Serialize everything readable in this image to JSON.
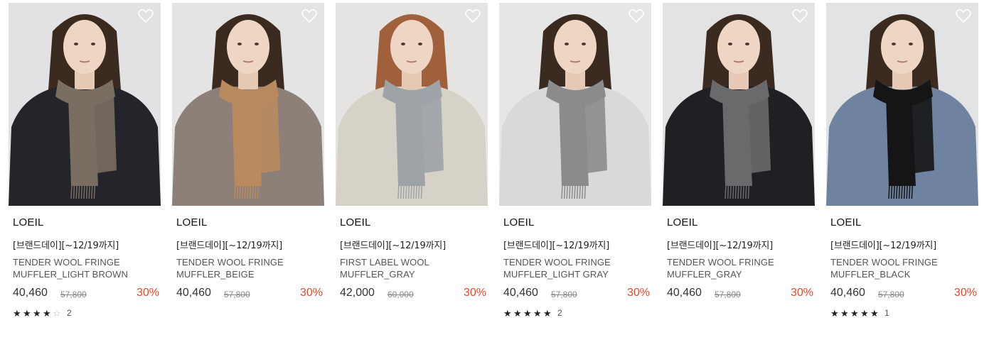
{
  "products": [
    {
      "brand": "LOEIL",
      "promo": "[브랜드데이][~12/19까지]",
      "name_line1": "TENDER WOOL FRINGE",
      "name_line2": "MUFFLER_LIGHT BROWN",
      "price": "40,460",
      "original_price": "57,800",
      "discount": "30%",
      "rating": {
        "stars": 4,
        "max": 5,
        "count": "2"
      },
      "scarf_color": "#7a6d62",
      "top_color": "#24242a",
      "background_color": "#e2e2e4",
      "hair_color": "#3a2a20"
    },
    {
      "brand": "LOEIL",
      "promo": "[브랜드데이][~12/19까지]",
      "name_line1": "TENDER WOOL FRINGE",
      "name_line2": "MUFFLER_BEIGE",
      "price": "40,460",
      "original_price": "57,800",
      "discount": "30%",
      "rating": null,
      "scarf_color": "#b98a5e",
      "top_color": "#8d8079",
      "background_color": "#e4e4e4",
      "hair_color": "#3a2a20"
    },
    {
      "brand": "LOEIL",
      "promo": "[브랜드데이][~12/19까지]",
      "name_line1": "FIRST LABEL WOOL",
      "name_line2": "MUFFLER_GRAY",
      "price": "42,000",
      "original_price": "60,000",
      "discount": "30%",
      "rating": null,
      "scarf_color": "#9ea3a8",
      "top_color": "#d6d2c8",
      "background_color": "#e5e4e2",
      "hair_color": "#a0603c"
    },
    {
      "brand": "LOEIL",
      "promo": "[브랜드데이][~12/19까지]",
      "name_line1": "TENDER WOOL FRINGE",
      "name_line2": "MUFFLER_LIGHT GRAY",
      "price": "40,460",
      "original_price": "57,800",
      "discount": "30%",
      "rating": {
        "stars": 5,
        "max": 5,
        "count": "2"
      },
      "scarf_color": "#8b8b8d",
      "top_color": "#d9d9d9",
      "background_color": "#e6e6e6",
      "hair_color": "#3a2a20"
    },
    {
      "brand": "LOEIL",
      "promo": "[브랜드데이][~12/19까지]",
      "name_line1": "TENDER WOOL FRINGE",
      "name_line2": "MUFFLER_GRAY",
      "price": "40,460",
      "original_price": "57,800",
      "discount": "30%",
      "rating": null,
      "scarf_color": "#6a6a6c",
      "top_color": "#1f1f24",
      "background_color": "#e3e3e4",
      "hair_color": "#3a2a20"
    },
    {
      "brand": "LOEIL",
      "promo": "[브랜드데이][~12/19까지]",
      "name_line1": "TENDER WOOL FRINGE",
      "name_line2": "MUFFLER_BLACK",
      "price": "40,460",
      "original_price": "57,800",
      "discount": "30%",
      "rating": {
        "stars": 5,
        "max": 5,
        "count": "1"
      },
      "scarf_color": "#151515",
      "top_color": "#6f82a0",
      "background_color": "#e2e3e5",
      "hair_color": "#3a2a20"
    }
  ],
  "icons": {
    "wishlist": "heart-outline-icon",
    "star": "star-icon"
  },
  "colors": {
    "discount": "#e8492c",
    "text": "#222222",
    "muted": "#888888"
  }
}
